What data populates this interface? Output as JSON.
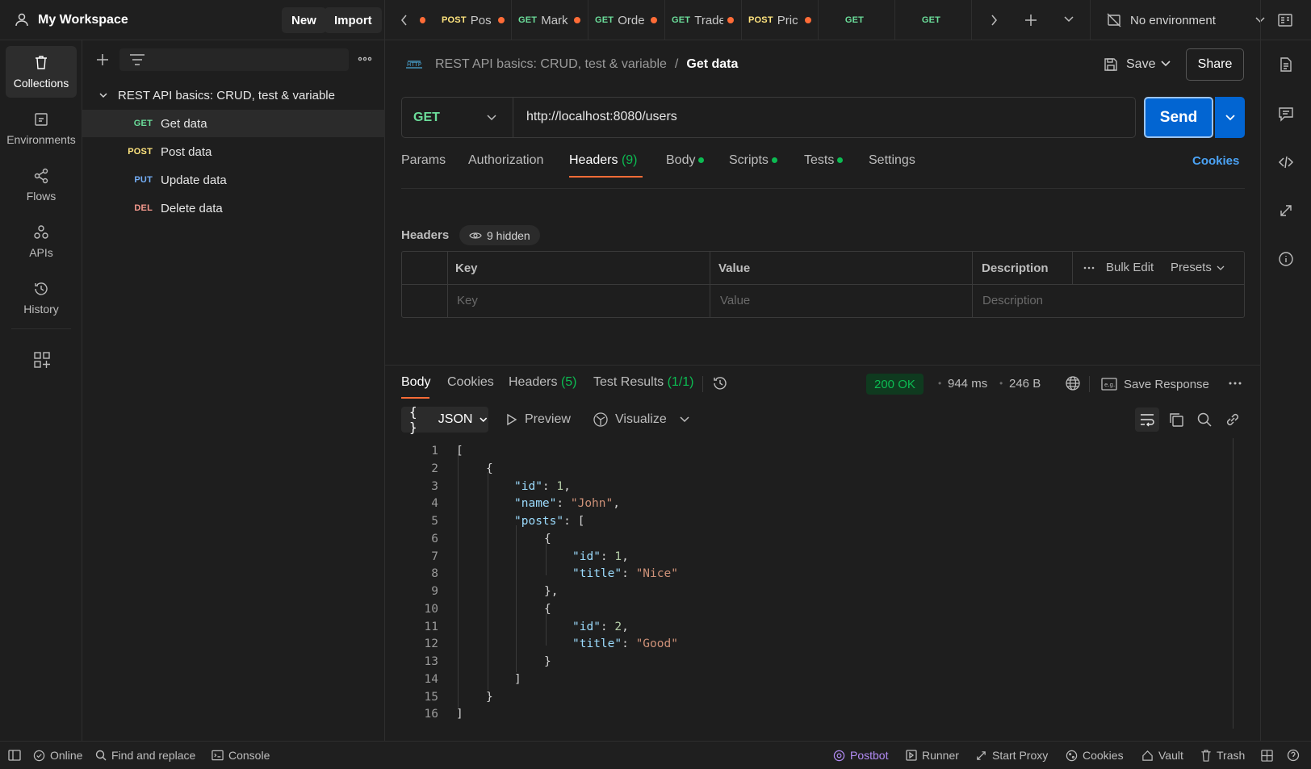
{
  "workspace": {
    "name": "My Workspace",
    "new_label": "New",
    "import_label": "Import"
  },
  "tabs": [
    {
      "method": "POST",
      "name": "Pos"
    },
    {
      "method": "GET",
      "name": "Mark"
    },
    {
      "method": "GET",
      "name": "Orde"
    },
    {
      "method": "GET",
      "name": "Trade"
    },
    {
      "method": "POST",
      "name": "Pric"
    },
    {
      "method": "GET",
      "name": ""
    },
    {
      "method": "GET",
      "name": ""
    }
  ],
  "environment": "No environment",
  "rail": {
    "collections": "Collections",
    "environments": "Environments",
    "flows": "Flows",
    "apis": "APIs",
    "history": "History"
  },
  "collection": {
    "name": "REST API basics: CRUD, test & variable",
    "requests": [
      {
        "method": "GET",
        "name": "Get data"
      },
      {
        "method": "POST",
        "name": "Post data"
      },
      {
        "method": "PUT",
        "name": "Update data"
      },
      {
        "method": "DEL",
        "name": "Delete data"
      }
    ]
  },
  "request": {
    "breadcrumb_parent": "REST API basics: CRUD, test & variable",
    "breadcrumb_sep": "/",
    "title": "Get data",
    "save_label": "Save",
    "share_label": "Share",
    "method": "GET",
    "url": "http://localhost:8080/users",
    "send_label": "Send",
    "tabs": {
      "params": "Params",
      "authorization": "Authorization",
      "headers": "Headers",
      "headers_count": "(9)",
      "body": "Body",
      "scripts": "Scripts",
      "tests": "Tests",
      "settings": "Settings"
    },
    "cookies_label": "Cookies",
    "headers_title": "Headers",
    "hidden_label": "9 hidden",
    "table": {
      "key": "Key",
      "value": "Value",
      "description": "Description",
      "bulk_edit": "Bulk Edit",
      "presets": "Presets",
      "key_placeholder": "Key",
      "value_placeholder": "Value",
      "description_placeholder": "Description"
    }
  },
  "response": {
    "tabs": {
      "body": "Body",
      "cookies": "Cookies",
      "headers": "Headers",
      "headers_count": "(5)",
      "tests": "Test Results",
      "tests_count": "(1/1)"
    },
    "status": "200 OK",
    "time": "944 ms",
    "size": "246 B",
    "save_label": "Save Response",
    "format": "JSON",
    "preview_label": "Preview",
    "visualize_label": "Visualize",
    "line_numbers": [
      "1",
      "2",
      "3",
      "4",
      "5",
      "6",
      "7",
      "8",
      "9",
      "10",
      "11",
      "12",
      "13",
      "14",
      "15",
      "16"
    ]
  },
  "statusbar": {
    "online": "Online",
    "find": "Find and replace",
    "console": "Console",
    "postbot": "Postbot",
    "runner": "Runner",
    "proxy": "Start Proxy",
    "cookies": "Cookies",
    "vault": "Vault",
    "trash": "Trash"
  },
  "colors": {
    "accent": "#ff6c37",
    "send": "#0265d2",
    "status_ok": "#0cbb52"
  }
}
